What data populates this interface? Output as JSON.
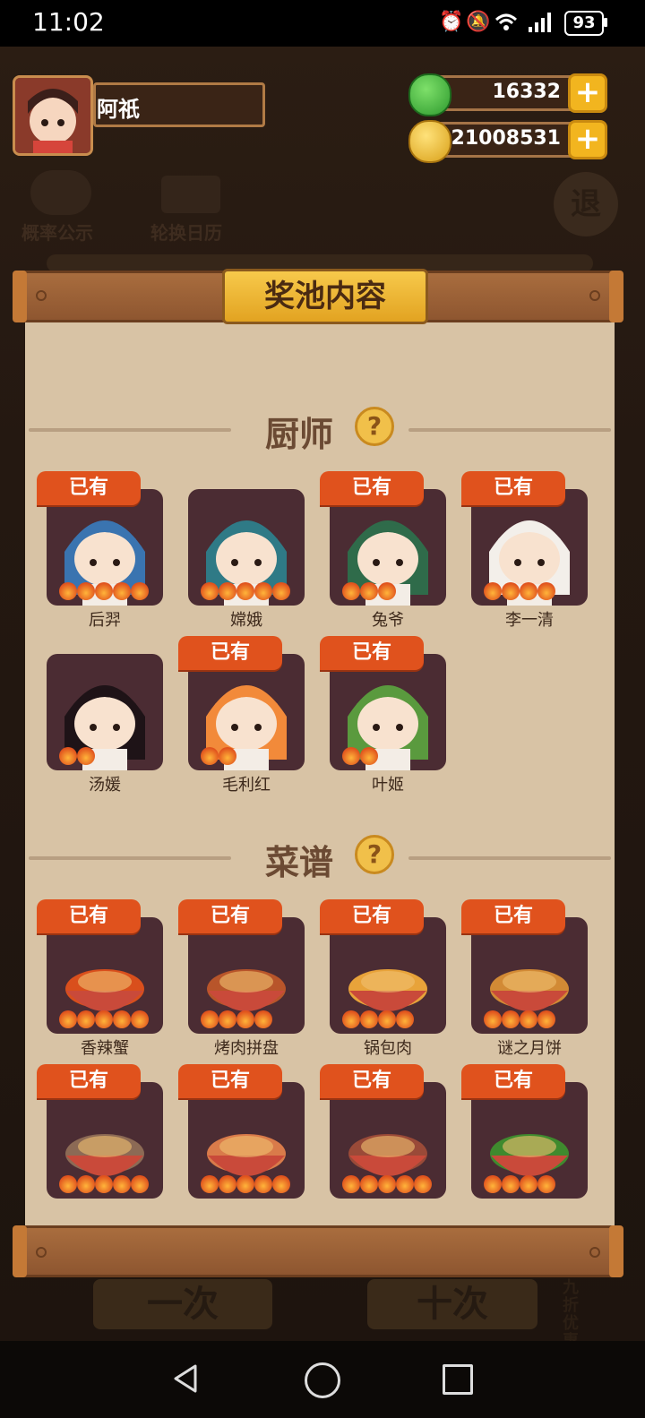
{
  "status_bar": {
    "time": "11:02",
    "battery": "93",
    "icons": [
      "alarm-icon",
      "mute-icon",
      "wifi-icon",
      "signal-4g-icon"
    ]
  },
  "player": {
    "name": "阿祇"
  },
  "currency": {
    "jade": "16332",
    "coins": "21008531"
  },
  "background_labels": {
    "probability": "概率公示",
    "calendar": "轮换日历",
    "exit": "退",
    "draw_one": "一次",
    "draw_ten": "十次",
    "discount": "九折优惠"
  },
  "modal": {
    "title": "奖池内容",
    "owned_label": "已有",
    "chefs_title": "厨师",
    "recipes_title": "菜谱",
    "help_symbol": "?"
  },
  "chefs": [
    {
      "name": "后羿",
      "owned": true,
      "stars": 5,
      "hair": "#3a74b0"
    },
    {
      "name": "嫦娥",
      "owned": false,
      "stars": 5,
      "hair": "#2f7a86"
    },
    {
      "name": "兔爷",
      "owned": true,
      "stars": 3,
      "hair": "#2f6b4a"
    },
    {
      "name": "李一清",
      "owned": true,
      "stars": 4,
      "hair": "#f3efea"
    },
    {
      "name": "汤媛",
      "owned": false,
      "stars": 2,
      "hair": "#1e1317"
    },
    {
      "name": "毛利红",
      "owned": true,
      "stars": 2,
      "hair": "#f28a3a"
    },
    {
      "name": "叶姬",
      "owned": true,
      "stars": 2,
      "hair": "#5a9a3e"
    }
  ],
  "recipes": [
    {
      "name": "香辣蟹",
      "owned": true,
      "stars": 5,
      "color": "#d94f1c"
    },
    {
      "name": "烤肉拼盘",
      "owned": true,
      "stars": 4,
      "color": "#b8552a"
    },
    {
      "name": "锅包肉",
      "owned": true,
      "stars": 4,
      "color": "#e8a33a"
    },
    {
      "name": "谜之月饼",
      "owned": true,
      "stars": 4,
      "color": "#d28a35"
    },
    {
      "name": "",
      "owned": true,
      "stars": 5,
      "color": "#8c6a55"
    },
    {
      "name": "",
      "owned": true,
      "stars": 5,
      "color": "#d97b4a"
    },
    {
      "name": "",
      "owned": true,
      "stars": 5,
      "color": "#9a4a38"
    },
    {
      "name": "",
      "owned": true,
      "stars": 4,
      "color": "#3f8a2e"
    }
  ]
}
